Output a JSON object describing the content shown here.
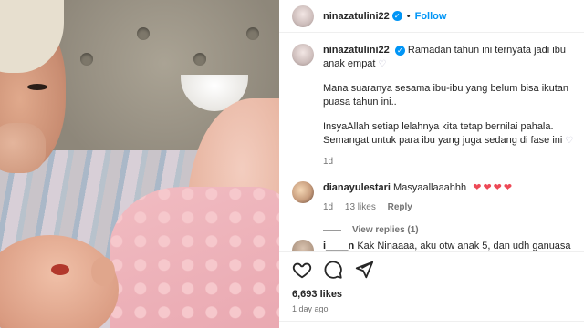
{
  "post": {
    "username": "ninazatulini22",
    "follow_label": "Follow",
    "separator": "•"
  },
  "caption": {
    "line1": "Ramadan tahun ini ternyata jadi ibu anak empat",
    "para2": "Mana suaranya sesama ibu-ibu yang belum bisa ikutan puasa tahun ini..",
    "para3": "InsyaAllah setiap lelahnya kita tetap bernilai pahala. Semangat untuk para ibu yang juga sedang di fase ini",
    "time": "1d"
  },
  "comments": [
    {
      "username": "dianayulestari",
      "text": "Masyaallaaahhh",
      "hearts": "❤❤❤❤",
      "time": "1d",
      "likes": "13 likes",
      "reply_label": "Reply",
      "view_replies": "View replies (1)"
    },
    {
      "username": "i____n",
      "text": "Kak Ninaaaa, aku otw anak 5, dan udh ganuasa"
    }
  ],
  "actions": {
    "likes": "6,693 likes",
    "posted_ago": "1 day ago"
  },
  "colors": {
    "accent": "#0095f6",
    "heart_red": "#ed4956",
    "muted": "#737373",
    "text": "#262626"
  },
  "icons": [
    "heart-icon",
    "comment-icon",
    "share-icon",
    "verified-badge-icon",
    "white-heart-icon"
  ]
}
